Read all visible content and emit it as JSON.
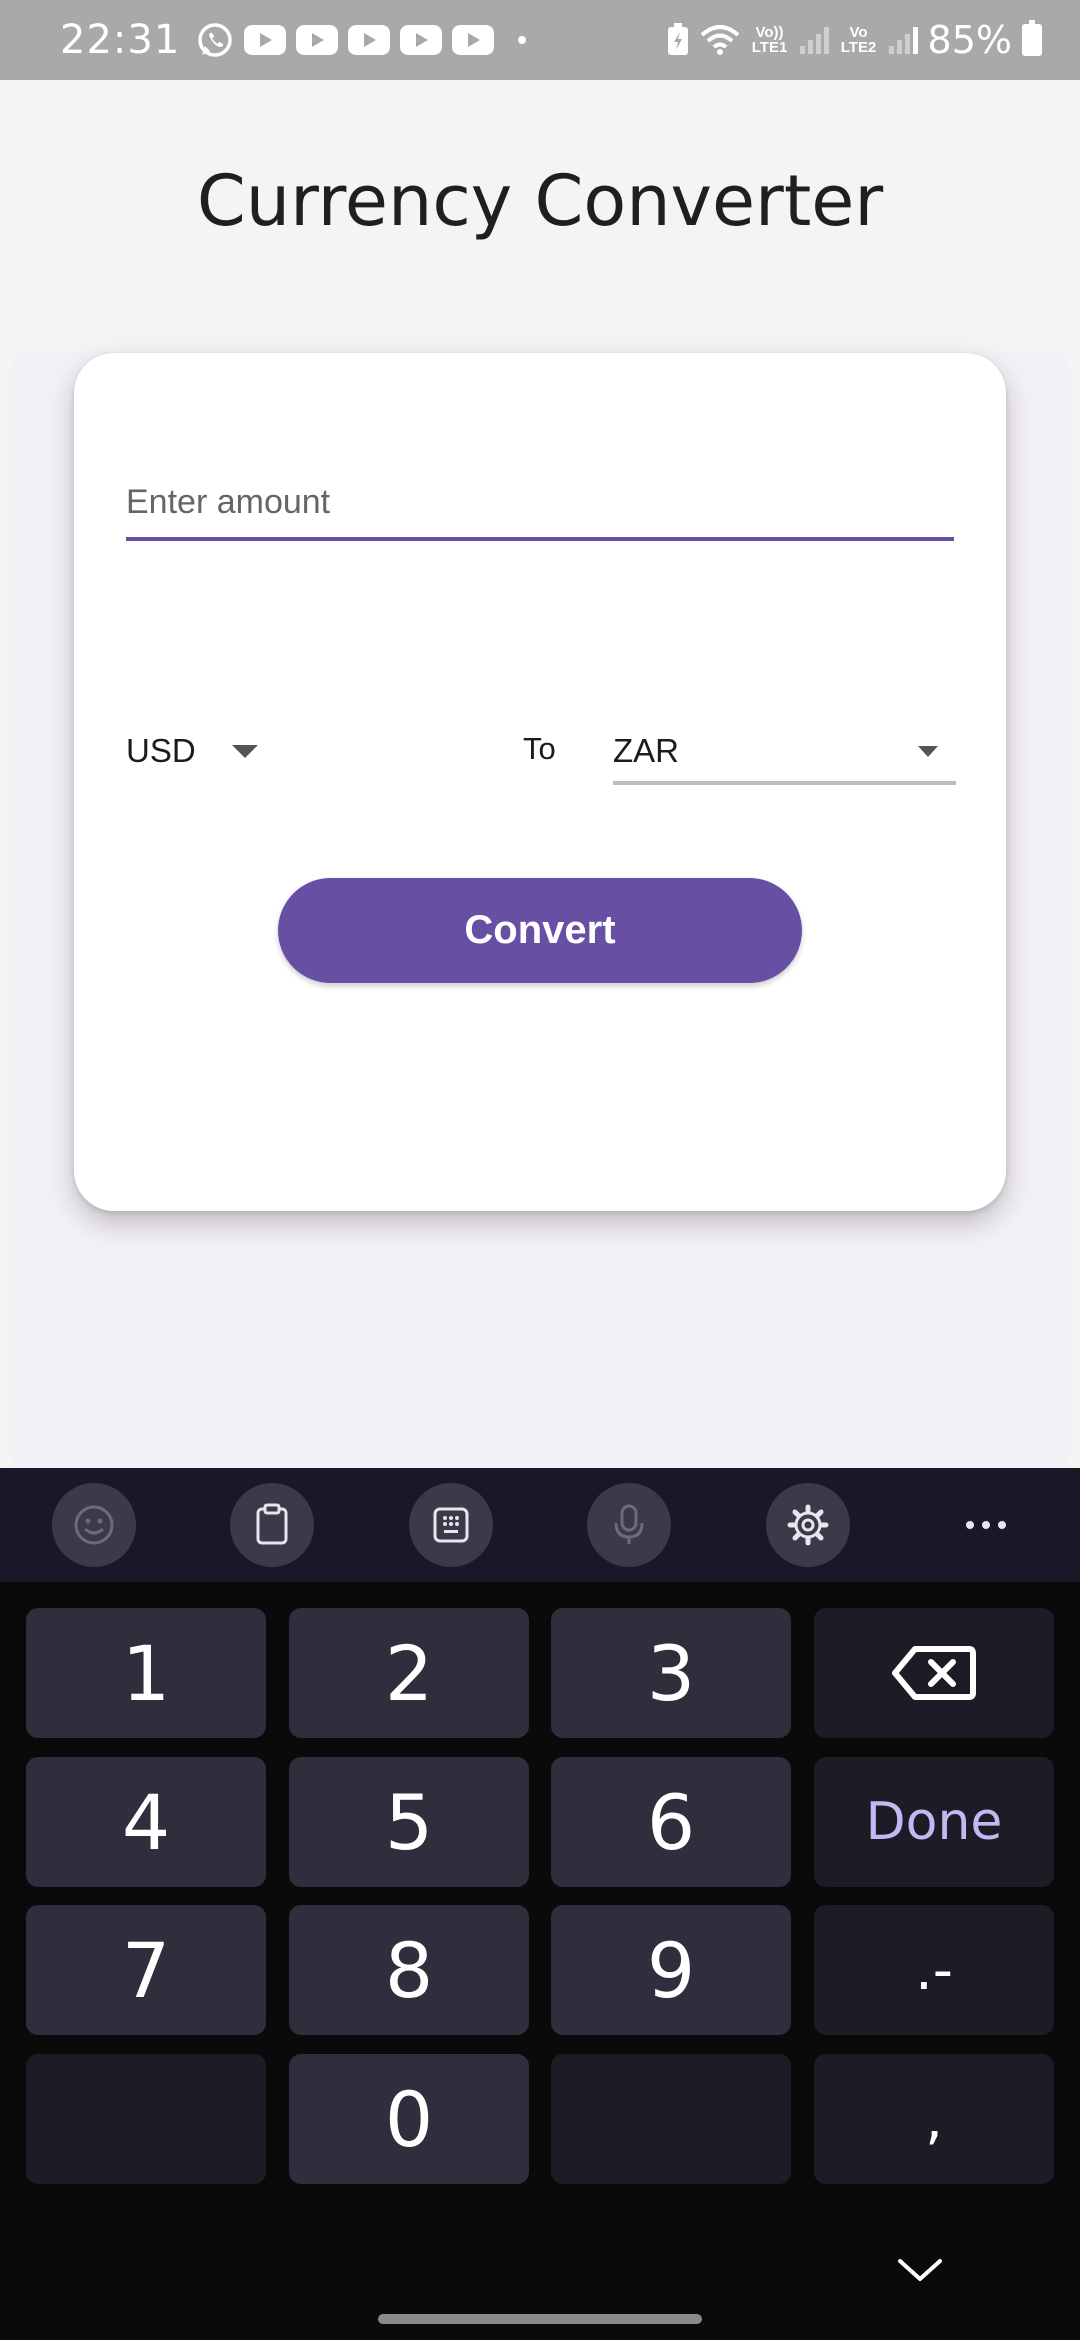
{
  "status_bar": {
    "time": "22:31",
    "sim1": "Vo)) LTE1",
    "sim2": "Vo LTE2",
    "battery": "85%"
  },
  "app": {
    "title": "Currency Converter",
    "amount_placeholder": "Enter amount",
    "amount_value": "",
    "from_currency": "USD",
    "to_label": "To",
    "to_currency": "ZAR",
    "convert_label": "Convert",
    "accent_color": "#6750a4"
  },
  "keyboard": {
    "toolbar_icons": [
      "emoji-icon",
      "clipboard-icon",
      "keypad-icon",
      "microphone-icon",
      "settings-icon",
      "more-icon"
    ],
    "keys": {
      "k1": "1",
      "k2": "2",
      "k3": "3",
      "k4": "4",
      "k5": "5",
      "k6": "6",
      "done": "Done",
      "k7": "7",
      "k8": "8",
      "k9": "9",
      "dot_dash": ".-",
      "k0": "0",
      "comma": ","
    }
  }
}
